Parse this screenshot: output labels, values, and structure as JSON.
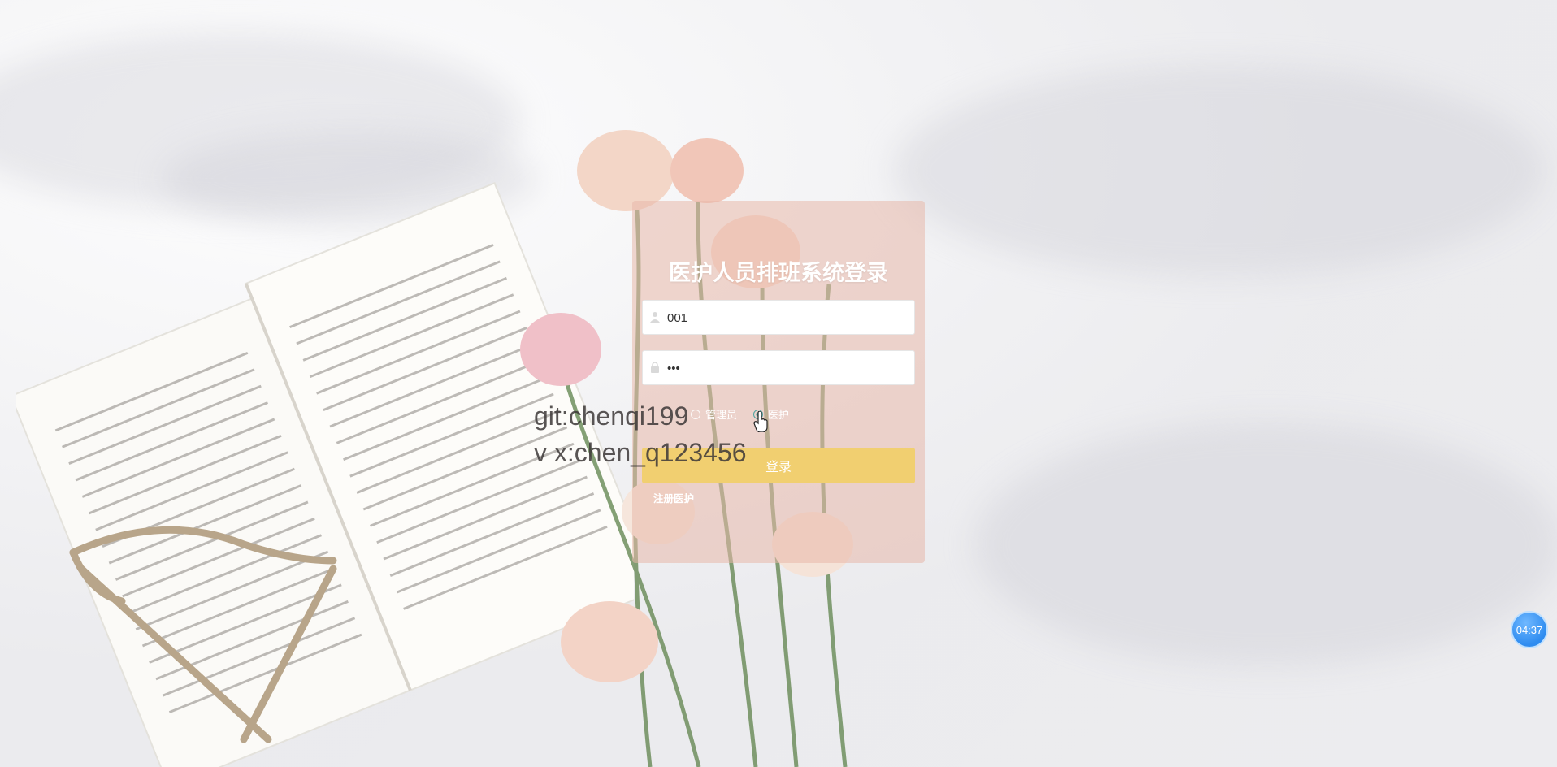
{
  "login": {
    "title": "医护人员排班系统登录",
    "username_value": "001",
    "password_value": "•••",
    "roles": [
      {
        "label": "管理员",
        "checked": false
      },
      {
        "label": "医护",
        "checked": true
      }
    ],
    "submit_label": "登录",
    "register_link": "注册医护"
  },
  "watermark": {
    "line1": "git:chenqi199",
    "line2": "v x:chen_q123456"
  },
  "timer": {
    "time": "04:37"
  },
  "colors": {
    "card_bg": "#e8b8aa",
    "button_bg": "#f1cf70",
    "radio_checked": "#4aa3a0",
    "timer_bg": "#2f8cf0"
  },
  "icons": [
    "user-icon",
    "lock-icon",
    "cursor-hand-icon"
  ]
}
